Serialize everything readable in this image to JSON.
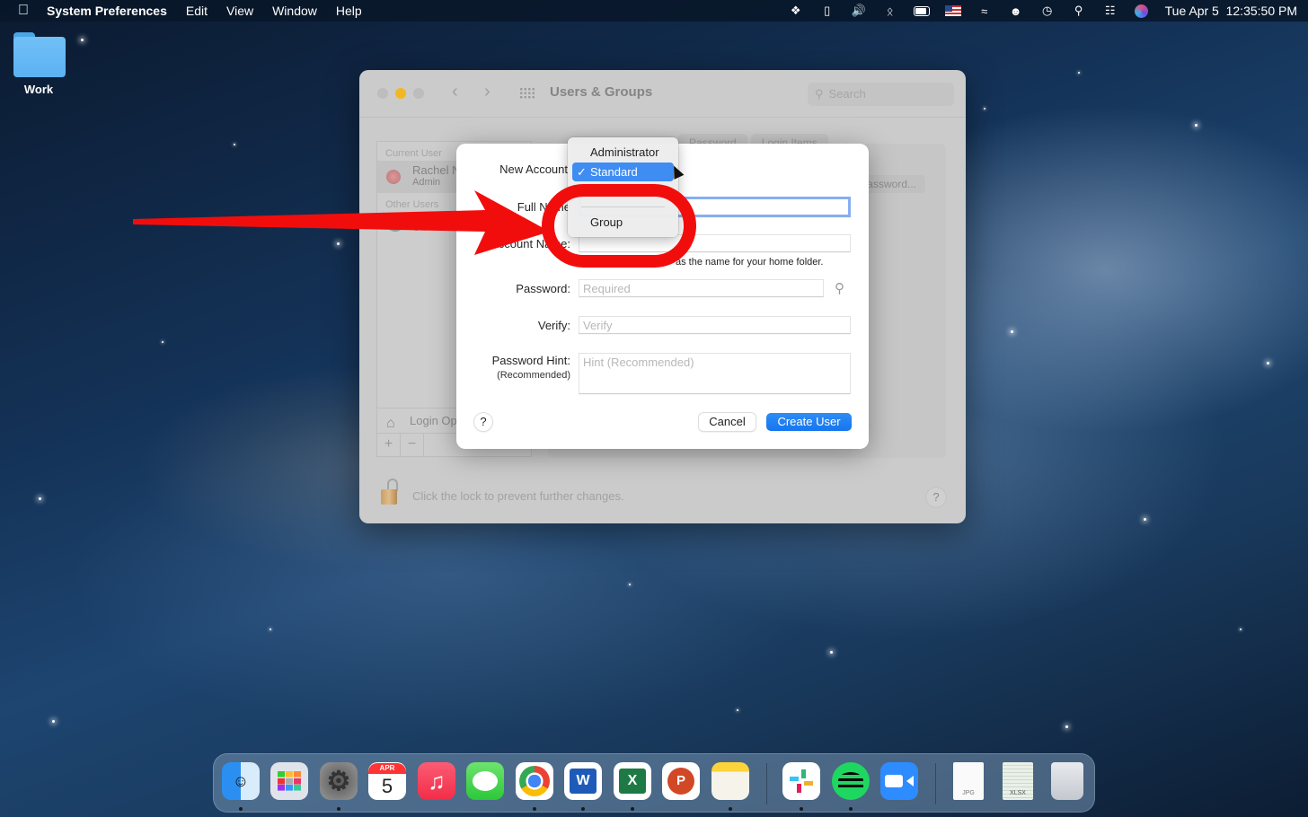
{
  "menubar": {
    "app_name": "System Preferences",
    "menus": [
      "Edit",
      "View",
      "Window",
      "Help"
    ],
    "status_icons": [
      "dropbox-icon",
      "phone-icon",
      "volume-icon",
      "bluetooth-icon",
      "battery-icon",
      "input-flag-icon",
      "wifi-icon",
      "user-icon",
      "time-machine-icon",
      "spotlight-icon",
      "control-center-icon",
      "siri-icon"
    ],
    "clock": "Tue Apr 5  12:35:50 PM"
  },
  "desktop": {
    "icons": [
      {
        "label": "Work",
        "type": "folder"
      }
    ]
  },
  "window": {
    "title": "Users & Groups",
    "search_placeholder": "Search",
    "tabs": [
      "Password",
      "Login Items"
    ],
    "change_password_label": "Change Password...",
    "user_list": {
      "current_section": "Current User",
      "current_user": {
        "name": "Rachel N",
        "role": "Admin"
      },
      "other_section": "Other Users",
      "guest": {
        "status": "Off"
      },
      "login_options": "Login Options",
      "add": "+",
      "remove": "−"
    },
    "lock_text": "Click the lock to prevent further changes.",
    "help": "?"
  },
  "sheet": {
    "new_account_label": "New Account",
    "full_name_label": "Full Name",
    "account_name_label": "Account Name:",
    "home_folder_hint": "as the name for your home folder.",
    "password_label": "Password:",
    "password_placeholder": "Required",
    "verify_label": "Verify:",
    "verify_placeholder": "Verify",
    "hint_label": "Password Hint:",
    "hint_sublabel": "(Recommended)",
    "hint_placeholder": "Hint (Recommended)",
    "help": "?",
    "cancel": "Cancel",
    "create": "Create User"
  },
  "popup_menu": {
    "options": [
      {
        "label": "Administrator",
        "selected": false
      },
      {
        "label": "Standard",
        "selected": true
      },
      {
        "label": "Group",
        "selected": false
      }
    ],
    "checkmark": "✓"
  },
  "annotation": {
    "color": "#f20d0d",
    "target": "Group"
  },
  "dock": {
    "apps": [
      {
        "name": "Finder",
        "running": true
      },
      {
        "name": "Launchpad",
        "running": false
      },
      {
        "name": "System Preferences",
        "running": true
      },
      {
        "name": "Calendar",
        "running": false,
        "month": "APR",
        "day": "5"
      },
      {
        "name": "Music",
        "running": false
      },
      {
        "name": "Messages",
        "running": false
      },
      {
        "name": "Chrome",
        "running": true
      },
      {
        "name": "Word",
        "running": true,
        "letter": "W"
      },
      {
        "name": "Excel",
        "running": true,
        "letter": "X"
      },
      {
        "name": "PowerPoint",
        "running": false,
        "letter": "P"
      },
      {
        "name": "Notes",
        "running": true
      },
      {
        "name": "Slack",
        "running": true
      },
      {
        "name": "Spotify",
        "running": true
      },
      {
        "name": "Zoom",
        "running": false
      },
      {
        "name": "JPG file",
        "running": false,
        "ext": "JPG"
      },
      {
        "name": "XLSX file",
        "running": false,
        "ext": "XLSX"
      },
      {
        "name": "Trash",
        "running": false
      }
    ]
  }
}
